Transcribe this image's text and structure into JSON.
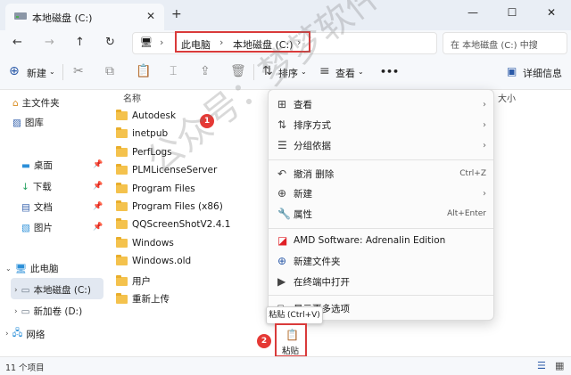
{
  "tab": {
    "title": "本地磁盘 (C:)",
    "close": "✕",
    "new": "+"
  },
  "window": {
    "minimize": "—",
    "maximize": "☐",
    "close": "✕"
  },
  "address": {
    "crumbs": [
      "此电脑",
      "本地磁盘 (C:)"
    ],
    "search_placeholder": "在 本地磁盘 (C:) 中搜"
  },
  "toolbar": {
    "new_label": "新建",
    "sort_label": "排序",
    "view_label": "查看",
    "more": "•••",
    "details_label": "详细信息"
  },
  "nav": {
    "quick": [
      {
        "label": "主文件夹",
        "icon": "home-icon"
      },
      {
        "label": "图库",
        "icon": "gallery-icon"
      }
    ],
    "pinned": [
      {
        "label": "桌面"
      },
      {
        "label": "下载"
      },
      {
        "label": "文档"
      },
      {
        "label": "图片"
      }
    ],
    "this_pc": "此电脑",
    "drive_c": "本地磁盘 (C:)",
    "drive_d": "新加卷 (D:)",
    "network": "网络"
  },
  "files": {
    "col_name": "名称",
    "col_size": "大小",
    "items": [
      "Autodesk",
      "inetpub",
      "PerfLogs",
      "PLMLicenseServer",
      "Program Files",
      "Program Files (x86)",
      "QQScreenShotV2.4.1",
      "Windows",
      "Windows.old",
      "用户",
      "重新上传"
    ]
  },
  "context_menu": {
    "view": "查看",
    "sort": "排序方式",
    "group": "分组依据",
    "undo": "撤消 删除",
    "undo_shortcut": "Ctrl+Z",
    "new": "新建",
    "properties": "属性",
    "properties_shortcut": "Alt+Enter",
    "amd": "AMD Software: Adrenalin Edition",
    "new_folder": "新建文件夹",
    "terminal": "在终端中打开",
    "more_options": "显示更多选项"
  },
  "tooltip": "粘贴 (Ctrl+V)",
  "paste_label": "粘贴",
  "badges": {
    "one": "1",
    "two": "2"
  },
  "status": {
    "count": "11 个项目"
  },
  "watermark": "公众号：梦梦软件管家",
  "colors": {
    "accent": "#2b5aa8",
    "highlight": "#d93a3a",
    "folder": "#f4c24d"
  }
}
